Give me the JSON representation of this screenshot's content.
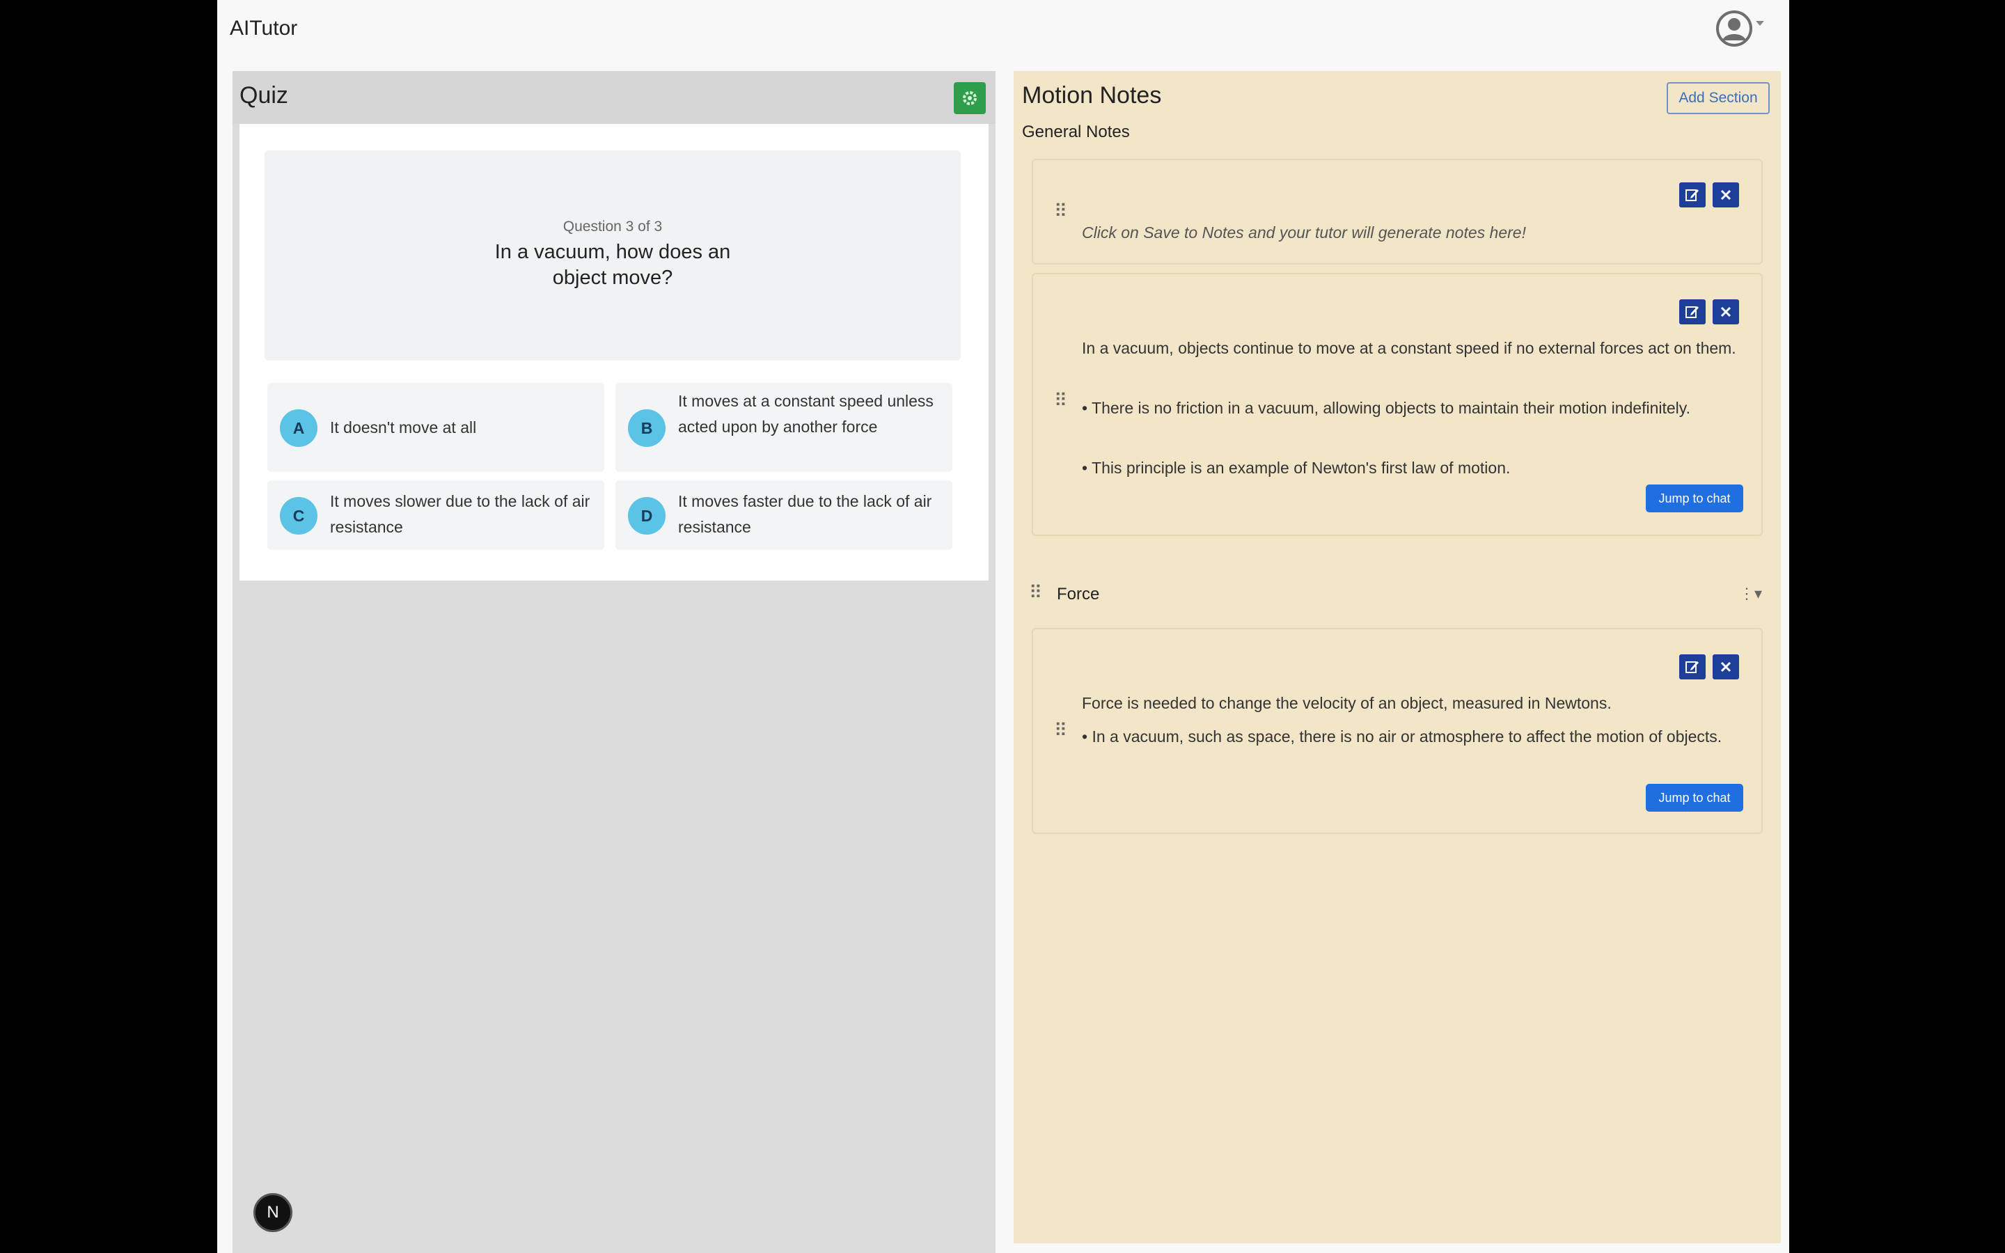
{
  "app": {
    "brand": "AITutor"
  },
  "quiz": {
    "title": "Quiz",
    "question_count": "Question 3 of 3",
    "question_text": "In a vacuum, how does an object move?",
    "options": [
      {
        "letter": "A",
        "text": "It doesn't move at all"
      },
      {
        "letter": "B",
        "text": "It moves at a constant speed unless acted upon by another force"
      },
      {
        "letter": "C",
        "text": "It moves slower due to the lack of air resistance"
      },
      {
        "letter": "D",
        "text": "It moves faster due to the lack of air resistance"
      }
    ]
  },
  "notes": {
    "title": "Motion Notes",
    "add_section_label": "Add Section",
    "general_label": "General Notes",
    "general_cards": [
      {
        "text": "Click on Save to Notes and your tutor will generate notes here!"
      },
      {
        "text": "In a vacuum, objects continue to move at a constant speed if no external forces act on them.",
        "bullets": [
          "• There is no friction in a vacuum, allowing objects to maintain their motion indefinitely.",
          "• This principle is an example of Newton's first law of motion."
        ],
        "jump_label": "Jump to chat"
      }
    ],
    "sections": [
      {
        "title": "Force",
        "cards": [
          {
            "text": "Force is needed to change the velocity of an object, measured in Newtons.",
            "bullets": [
              "• In a vacuum, such as space, there is no air or atmosphere to affect the motion of objects."
            ],
            "jump_label": "Jump to chat"
          }
        ]
      }
    ]
  },
  "colors": {
    "notes_bg": "#f3e6c8",
    "quiz_bg": "#dcdcdc",
    "primary": "#1f6fe0",
    "icon_button": "#1d3f9a",
    "settings_button": "#2f9e4a",
    "option_circle": "#5bc3e6"
  },
  "icons": {
    "user": "user-circle-icon",
    "settings": "gear-icon",
    "edit": "edit-icon",
    "delete": "close-icon",
    "drag": "drag-handle-icon",
    "kebab": "kebab-menu-icon",
    "next": "next-logo-icon"
  },
  "fab_label": "N"
}
